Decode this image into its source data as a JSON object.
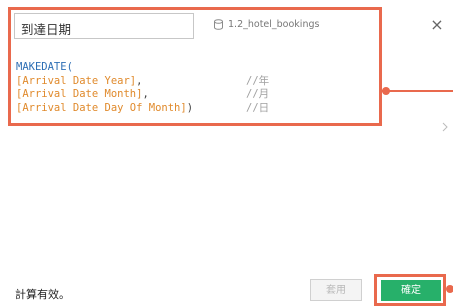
{
  "dialog": {
    "calc_name": "到達日期",
    "data_source": "1.2_hotel_bookings",
    "close_label": "×"
  },
  "formula": {
    "func": "MAKEDATE(",
    "lines": [
      {
        "field": "[Arrival Date Year]",
        "punct": ",",
        "comment": "//年"
      },
      {
        "field": "[Arrival Date Month]",
        "punct": ",",
        "comment": "//月"
      },
      {
        "field": "[Arrival Date Day Of Month]",
        "punct": ")",
        "comment": "//日"
      }
    ]
  },
  "footer": {
    "status": "計算有效。",
    "apply_label": "套用",
    "ok_label": "確定"
  },
  "colors": {
    "highlight": "#e9694d",
    "ok_green": "#27b06a",
    "function_blue": "#2e6fb5",
    "field_orange": "#e08a2c"
  }
}
